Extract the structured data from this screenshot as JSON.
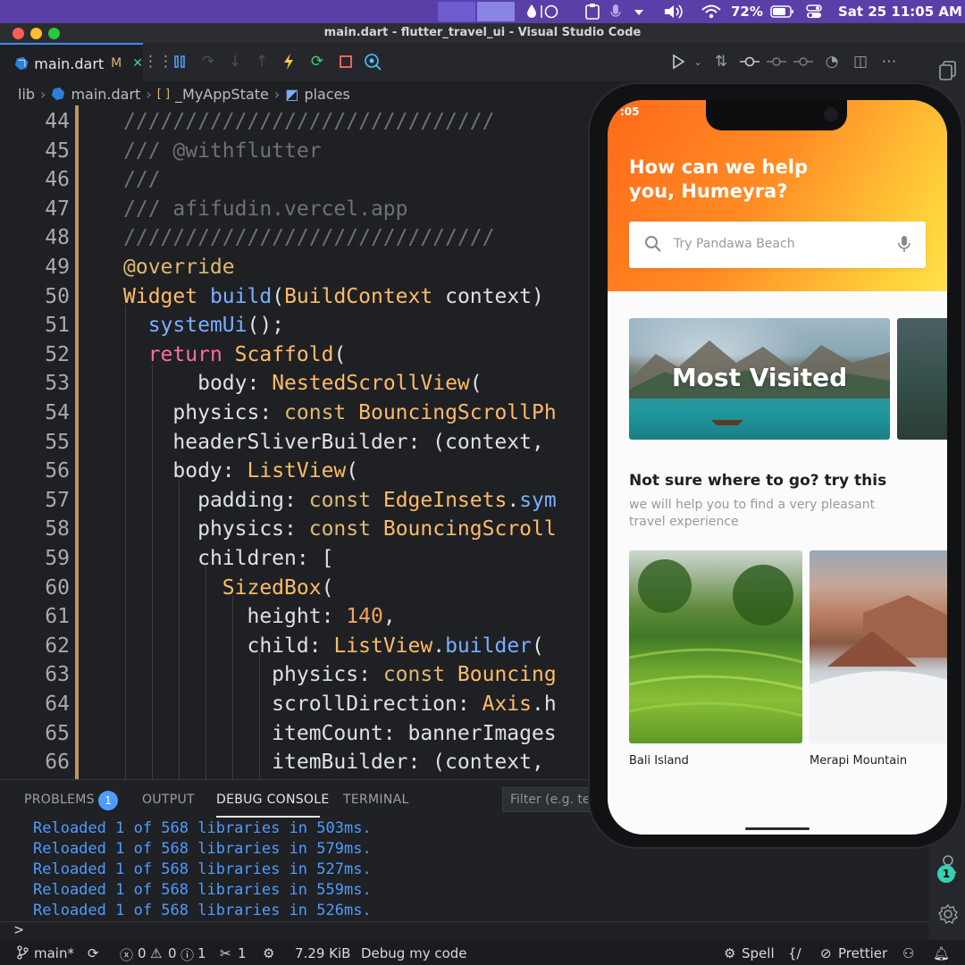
{
  "menubar": {
    "battery": "72%",
    "datetime": "Sat 25  11:05 AM"
  },
  "window": {
    "title": "main.dart - flutter_travel_ui - Visual Studio Code"
  },
  "tab": {
    "filename": "main.dart",
    "modified": "M",
    "close": "✕"
  },
  "breadcrumb": {
    "folder": "lib",
    "file": "main.dart",
    "class": "_MyAppState",
    "member": "places"
  },
  "editor": {
    "lines": [
      {
        "n": "44",
        "html": "<span class='cm'>//////////////////////////////</span>"
      },
      {
        "n": "45",
        "html": "<span class='cm'>/// @withflutter</span>"
      },
      {
        "n": "46",
        "html": "<span class='cm'>///</span>"
      },
      {
        "n": "47",
        "html": "<span class='cm'>/// afifudin.vercel.app</span>"
      },
      {
        "n": "48",
        "html": "<span class='cm'>//////////////////////////////</span>"
      },
      {
        "n": "49",
        "html": "<span class='kw'>@override</span>"
      },
      {
        "n": "50",
        "html": "<span class='ty'>Widget</span> <span class='fn'>build</span><span class='pl'>(</span><span class='ty'>BuildContext</span> <span class='pl'>context)</span>"
      },
      {
        "n": "51",
        "html": "  <span class='fn'>systemUi</span><span class='pl'>();</span>"
      },
      {
        "n": "52",
        "html": "  <span class='rt'>return</span> <span class='ty'>Scaffold</span><span class='pl'>(</span>"
      },
      {
        "n": "53",
        "html": "      <span class='pl'>body:</span> <span class='ty'>NestedScrollView</span><span class='pl'>(</span>"
      },
      {
        "n": "54",
        "html": "    <span class='pl'>physics:</span> <span class='kw'>const</span> <span class='ty'>BouncingScrollPh</span>"
      },
      {
        "n": "55",
        "html": "    <span class='pl'>headerSliverBuilder: (context,</span>"
      },
      {
        "n": "56",
        "html": "    <span class='pl'>body:</span> <span class='ty'>ListView</span><span class='pl'>(</span>"
      },
      {
        "n": "57",
        "html": "      <span class='pl'>padding:</span> <span class='kw'>const</span> <span class='ty'>EdgeInsets</span><span class='pl'>.</span><span class='fn'>sym</span>"
      },
      {
        "n": "58",
        "html": "      <span class='pl'>physics:</span> <span class='kw'>const</span> <span class='ty'>BouncingScroll</span>"
      },
      {
        "n": "59",
        "html": "      <span class='pl'>children: [</span>"
      },
      {
        "n": "60",
        "html": "        <span class='ty'>SizedBox</span><span class='pl'>(</span>"
      },
      {
        "n": "61",
        "html": "          <span class='pl'>height:</span> <span class='num'>140</span><span class='pl'>,</span>"
      },
      {
        "n": "62",
        "html": "          <span class='pl'>child:</span> <span class='ty'>ListView</span><span class='pl'>.</span><span class='fn'>builder</span><span class='pl'>(</span>"
      },
      {
        "n": "63",
        "html": "            <span class='pl'>physics:</span> <span class='kw'>const</span> <span class='ty'>Bouncing</span>"
      },
      {
        "n": "64",
        "html": "            <span class='pl'>scrollDirection:</span> <span class='ty'>Axis</span><span class='pl'>.h</span>"
      },
      {
        "n": "65",
        "html": "            <span class='pl'>itemCount: bannerImages</span>"
      },
      {
        "n": "66",
        "html": "            <span class='pl'>itemBuilder: (context,</span>"
      }
    ]
  },
  "panel": {
    "tabs": [
      "PROBLEMS",
      "OUTPUT",
      "DEBUG CONSOLE",
      "TERMINAL"
    ],
    "problems_count": "1",
    "filter_placeholder": "Filter (e.g. tex",
    "logs": [
      "Reloaded 1 of 568 libraries in 503ms.",
      "Reloaded 1 of 568 libraries in 579ms.",
      "Reloaded 1 of 568 libraries in 527ms.",
      "Reloaded 1 of 568 libraries in 559ms.",
      "Reloaded 1 of 568 libraries in 526ms."
    ],
    "prompt": ">"
  },
  "statusbar": {
    "branch": "main*",
    "errors": "0",
    "warnings": "0",
    "info": "1",
    "tools": "1",
    "size": "7.29 KiB",
    "debug": "Debug my code",
    "spell": "Spell",
    "prettier": "Prettier"
  },
  "activity": {
    "accounts_badge": "1"
  },
  "phone": {
    "status_time": ":05",
    "greeting": "How can we help you, Humeyra?",
    "search_placeholder": "Try Pandawa Beach",
    "banner_title": "Most Visited",
    "suggest_title": "Not sure where to go? try this",
    "suggest_subtitle": "we will help you to find a very pleasant travel experience",
    "places": [
      "Bali Island",
      "Merapi Mountain"
    ]
  },
  "colors": {
    "accent": "#4f9bff",
    "header_gradient_start": "#ff6a1a",
    "header_gradient_end": "#ffe24a"
  }
}
